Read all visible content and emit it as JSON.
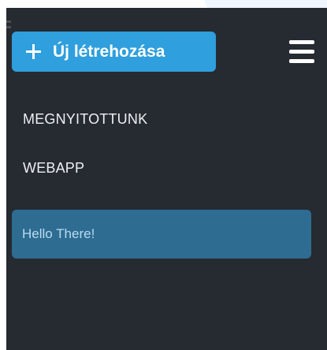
{
  "colors": {
    "sidebar_bg": "#262a31",
    "accent": "#2f9fdd",
    "selected_bg": "#2e6c92",
    "selected_text": "#b8dbf0",
    "nav_text": "#eef0f3"
  },
  "toolbar": {
    "create_label": "Új létrehozása",
    "create_icon": "plus-icon",
    "menu_icon": "hamburger-menu-icon"
  },
  "sidebar": {
    "items": [
      {
        "label": "MEGNYITOTTUNK"
      },
      {
        "label": "WEBAPP"
      }
    ],
    "selected_note": {
      "label": "Hello There!"
    }
  }
}
